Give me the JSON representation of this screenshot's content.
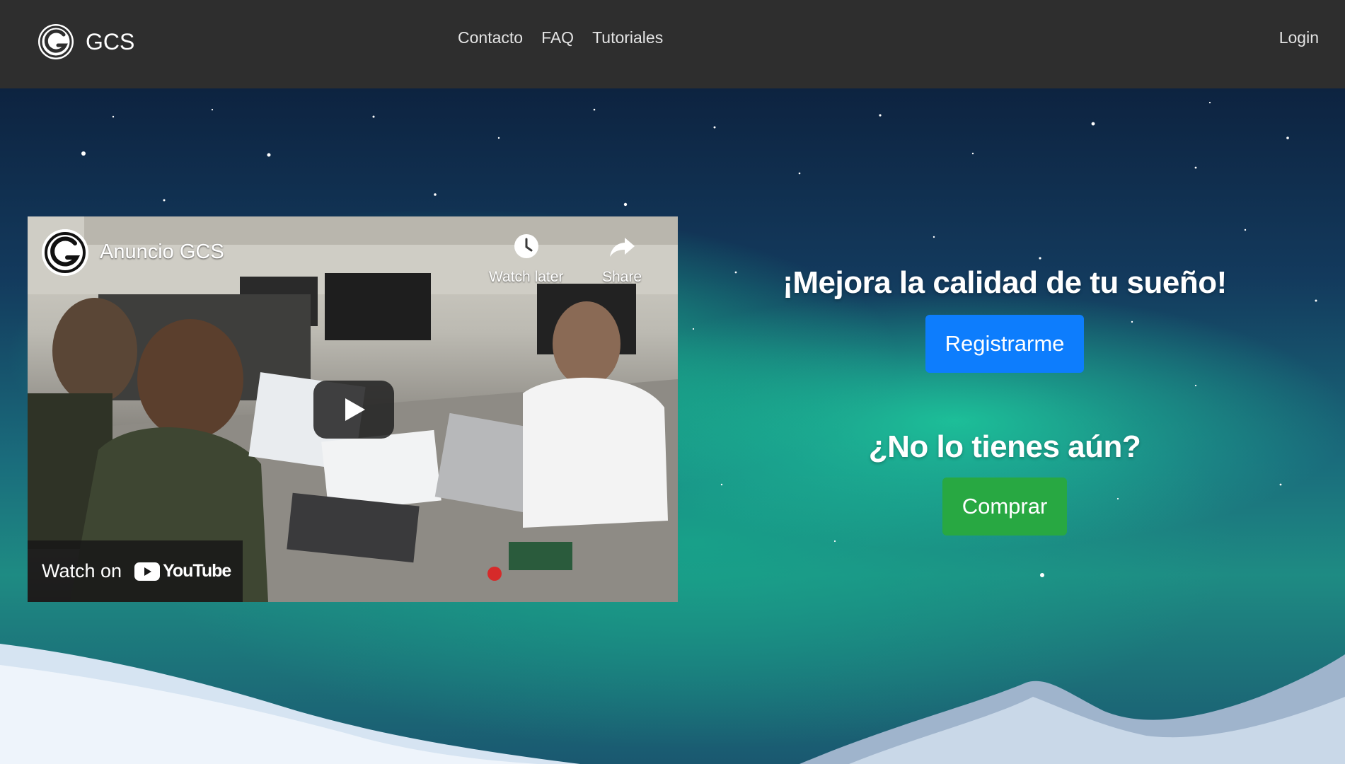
{
  "navbar": {
    "brand": "GCS",
    "links": [
      "Contacto",
      "FAQ",
      "Tutoriales"
    ],
    "login": "Login"
  },
  "video": {
    "title": "Anuncio GCS",
    "watch_later": "Watch later",
    "share": "Share",
    "watch_on": "Watch on",
    "platform": "YouTube"
  },
  "cta": {
    "heading_primary": "¡Mejora la calidad de tu sueño!",
    "register_button": "Registrarme",
    "heading_secondary": "¿No lo tienes aún?",
    "buy_button": "Comprar"
  },
  "colors": {
    "navbar_bg": "#2e2e2e",
    "primary": "#0d7dfd",
    "success": "#28a842"
  },
  "icons": [
    "gcs-logo-icon",
    "clock-icon",
    "share-arrow-icon",
    "play-icon",
    "youtube-logo-icon"
  ]
}
